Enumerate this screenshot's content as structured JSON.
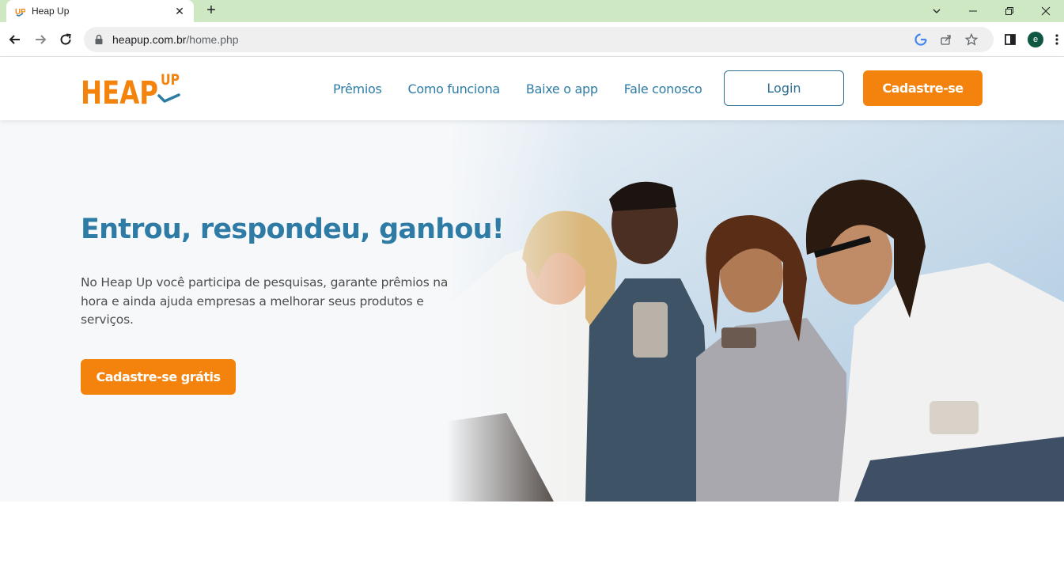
{
  "browser": {
    "tab_title": "Heap Up",
    "url_host": "heapup.com.br",
    "url_path": "/home.php",
    "profile_initial": "e"
  },
  "site": {
    "logo_text": "HEAP UP",
    "nav": [
      "Prêmios",
      "Como funciona",
      "Baixe o app",
      "Fale conosco"
    ],
    "login_label": "Login",
    "signup_label": "Cadastre-se"
  },
  "hero": {
    "title": "Entrou, respondeu, ganhou!",
    "description": "No Heap Up você participa de pesquisas, garante prêmios na hora e ainda ajuda empresas a melhorar seus produtos e serviços.",
    "cta_label": "Cadastre-se grátis"
  },
  "colors": {
    "brand_orange": "#f3830d",
    "brand_blue": "#2e7ca6",
    "chrome_tab_bar": "#cde8c2"
  }
}
